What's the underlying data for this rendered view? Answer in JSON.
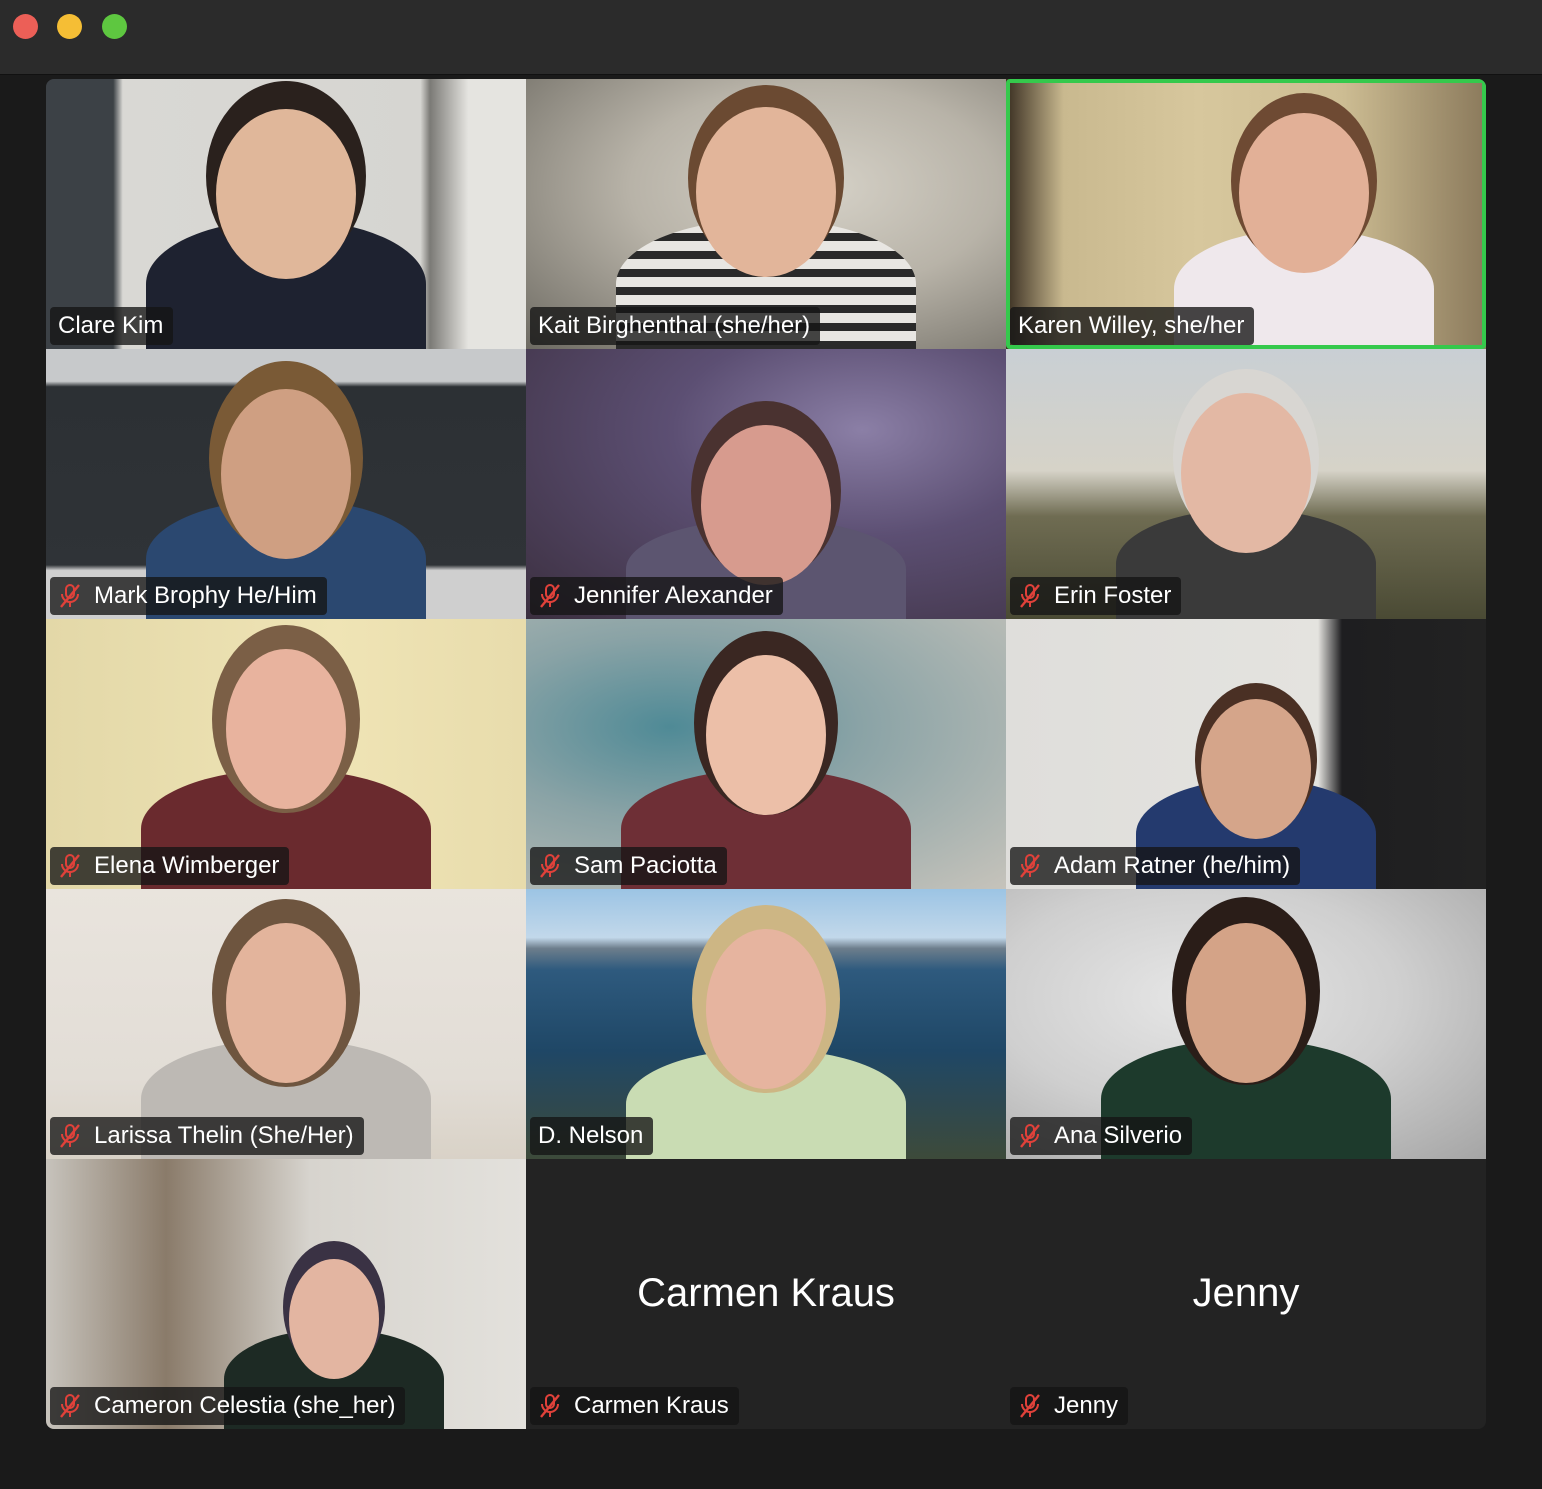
{
  "window": {
    "traffic_lights": {
      "close": "#ec5f57",
      "minimize": "#f5be35",
      "maximize": "#5ec740"
    }
  },
  "accent": {
    "active_speaker_border": "#35c94c",
    "mute_icon_color": "#e0413a"
  },
  "participants": [
    {
      "name": "Clare Kim",
      "muted": false,
      "video": true,
      "speaking": false
    },
    {
      "name": "Kait Birghenthal (she/her)",
      "muted": false,
      "video": true,
      "speaking": false
    },
    {
      "name": "Karen Willey, she/her",
      "muted": false,
      "video": true,
      "speaking": true
    },
    {
      "name": "Mark Brophy He/Him",
      "muted": true,
      "video": true,
      "speaking": false
    },
    {
      "name": "Jennifer Alexander",
      "muted": true,
      "video": true,
      "speaking": false
    },
    {
      "name": "Erin Foster",
      "muted": true,
      "video": true,
      "speaking": false
    },
    {
      "name": "Elena Wimberger",
      "muted": true,
      "video": true,
      "speaking": false
    },
    {
      "name": "Sam Paciotta",
      "muted": true,
      "video": true,
      "speaking": false
    },
    {
      "name": "Adam Ratner (he/him)",
      "muted": true,
      "video": true,
      "speaking": false
    },
    {
      "name": "Larissa Thelin (She/Her)",
      "muted": true,
      "video": true,
      "speaking": false
    },
    {
      "name": "D. Nelson",
      "muted": false,
      "video": true,
      "speaking": false
    },
    {
      "name": "Ana Silverio",
      "muted": true,
      "video": true,
      "speaking": false
    },
    {
      "name": "Cameron Celestia (she_her)",
      "muted": true,
      "video": true,
      "speaking": false
    },
    {
      "name": "Carmen Kraus",
      "muted": true,
      "video": false,
      "speaking": false
    },
    {
      "name": "Jenny",
      "muted": true,
      "video": false,
      "speaking": false
    }
  ]
}
